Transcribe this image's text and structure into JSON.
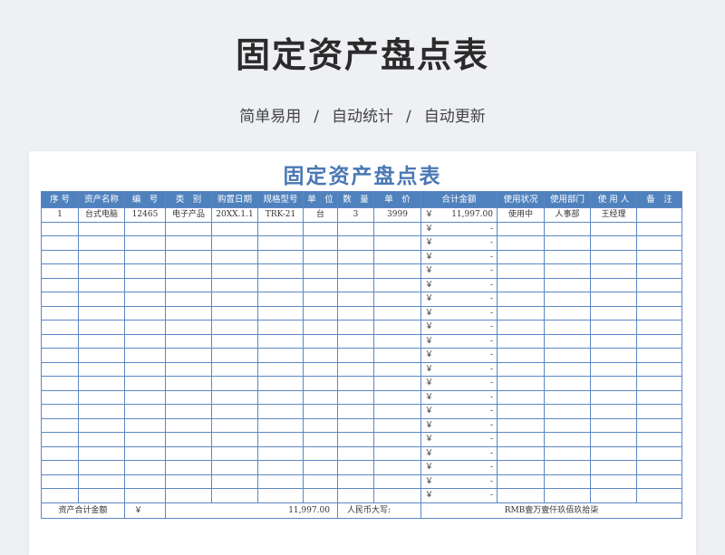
{
  "header": {
    "title": "固定资产盘点表",
    "subtitle_parts": [
      "简单易用",
      "自动统计",
      "自动更新"
    ],
    "separator": "/"
  },
  "sheet": {
    "title": "固定资产盘点表",
    "columns": [
      "序 号",
      "资产名称",
      "编　号",
      "类　别",
      "购置日期",
      "规格型号",
      "单　位",
      "数　量",
      "单　价",
      "合计金额",
      "使用状况",
      "使用部门",
      "使 用 人",
      "备　注"
    ],
    "currency_symbol": "￥",
    "empty_amount": "-",
    "rows": [
      {
        "no": "1",
        "name": "台式电脑",
        "code": "12465",
        "category": "电子产品",
        "date": "20XX.1.1",
        "spec": "TRK-21",
        "unit": "台",
        "qty": "3",
        "price": "3999",
        "total": "11,997.00",
        "status": "使用中",
        "dept": "人事部",
        "user": "王经理",
        "note": ""
      }
    ],
    "empty_row_count": 20,
    "footer": {
      "label": "资产合计金额",
      "currency": "￥",
      "total": "11,997.00",
      "rmb_label": "人民币大写:",
      "rmb_value": "RMB壹万壹仟玖佰玖拾柒"
    }
  },
  "colors": {
    "header_bg": "#4f81bd",
    "border": "#5b87c4",
    "sheet_title": "#4a78b4"
  }
}
